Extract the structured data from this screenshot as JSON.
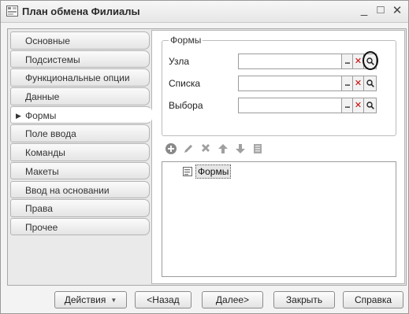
{
  "window": {
    "title": "План обмена Филиалы",
    "minimize": "_",
    "maximize": "□",
    "close": "✕"
  },
  "tabs": [
    {
      "label": "Основные"
    },
    {
      "label": "Подсистемы"
    },
    {
      "label": "Функциональные опции"
    },
    {
      "label": "Данные"
    },
    {
      "label": "Формы",
      "active": true
    },
    {
      "label": "Поле ввода"
    },
    {
      "label": "Команды"
    },
    {
      "label": "Макеты"
    },
    {
      "label": "Ввод на основании"
    },
    {
      "label": "Права"
    },
    {
      "label": "Прочее"
    }
  ],
  "forms_group": {
    "legend": "Формы",
    "fields": [
      {
        "label": "Узла",
        "value": ""
      },
      {
        "label": "Списка",
        "value": ""
      },
      {
        "label": "Выбора",
        "value": ""
      }
    ],
    "dots": "...",
    "clear": "✕"
  },
  "toolbar_icons": [
    "add-icon",
    "edit-icon",
    "delete-icon",
    "move-up-icon",
    "move-down-icon",
    "properties-icon"
  ],
  "tree": {
    "root_label": "Формы"
  },
  "buttons": {
    "actions": "Действия",
    "back": "<Назад",
    "next": "Далее>",
    "close": "Закрыть",
    "help": "Справка"
  },
  "colors": {
    "highlight_circle": "#111111",
    "clear_red": "#cc0000",
    "add_green": "#888888"
  }
}
